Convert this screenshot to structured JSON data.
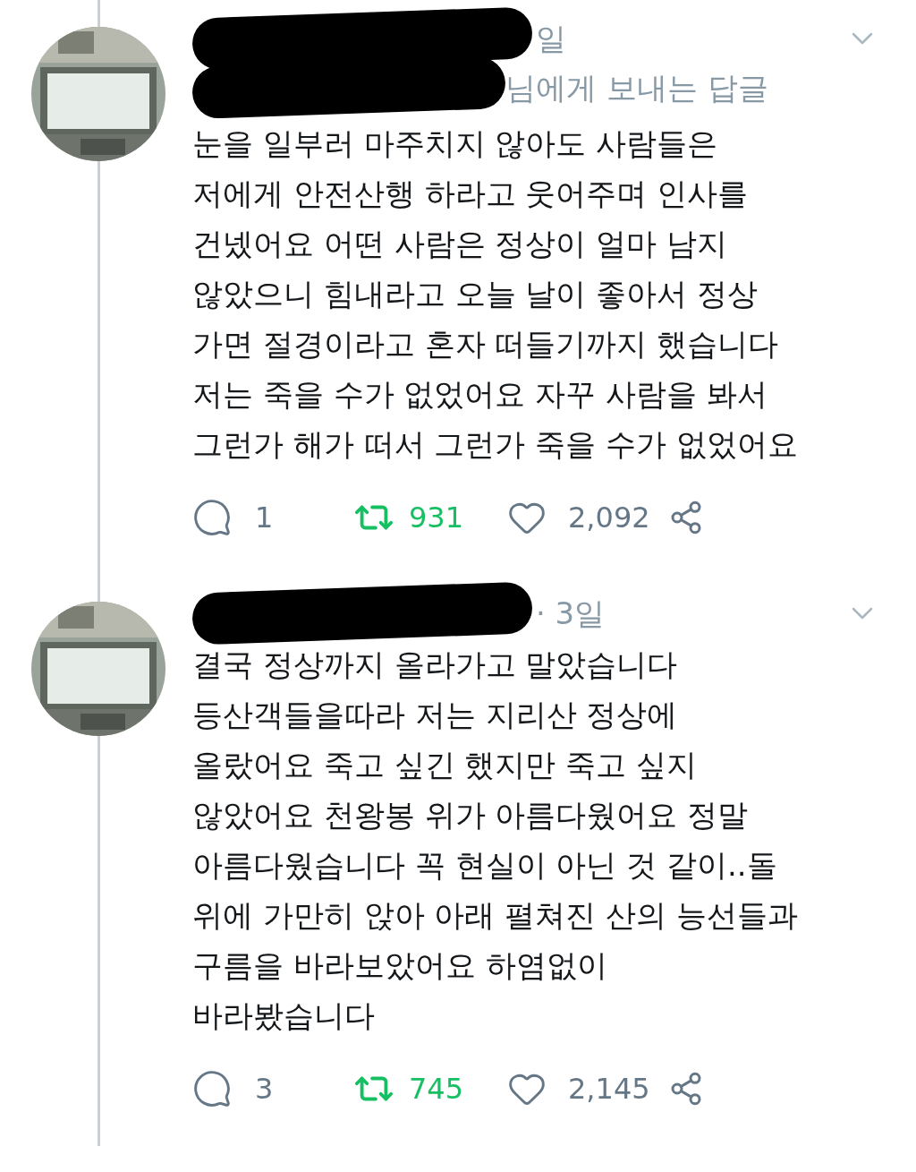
{
  "tweets": [
    {
      "time": "일",
      "reply_to": "님에게 보내는 답글",
      "text": "눈을 일부러 마주치지 않아도 사람들은\n저에게 안전산행 하라고 웃어주며 인사를\n건넸어요 어떤 사람은 정상이 얼마 남지\n않았으니 힘내라고 오늘 날이 좋아서 정상\n가면 절경이라고 혼자 떠들기까지 했습니다\n저는 죽을 수가 없었어요 자꾸 사람을 봐서\n그런가 해가 떠서 그런가 죽을 수가 없었어요",
      "replies": "1",
      "retweets": "931",
      "retweeted": true,
      "likes": "2,092"
    },
    {
      "time": "· 3일",
      "text": "결국 정상까지 올라가고 말았습니다\n등산객들을따라 저는 지리산 정상에\n올랐어요 죽고 싶긴 했지만 죽고 싶지\n않았어요 천왕봉 위가 아름다웠어요 정말\n아름다웠습니다 꼭 현실이 아닌 것 같이..돌\n위에 가만히 앉아 아래 펼쳐진 산의 능선들과\n구름을 바라보았어요 하염없이\n바라봤습니다",
      "replies": "3",
      "retweets": "745",
      "retweeted": true,
      "likes": "2,145"
    }
  ]
}
